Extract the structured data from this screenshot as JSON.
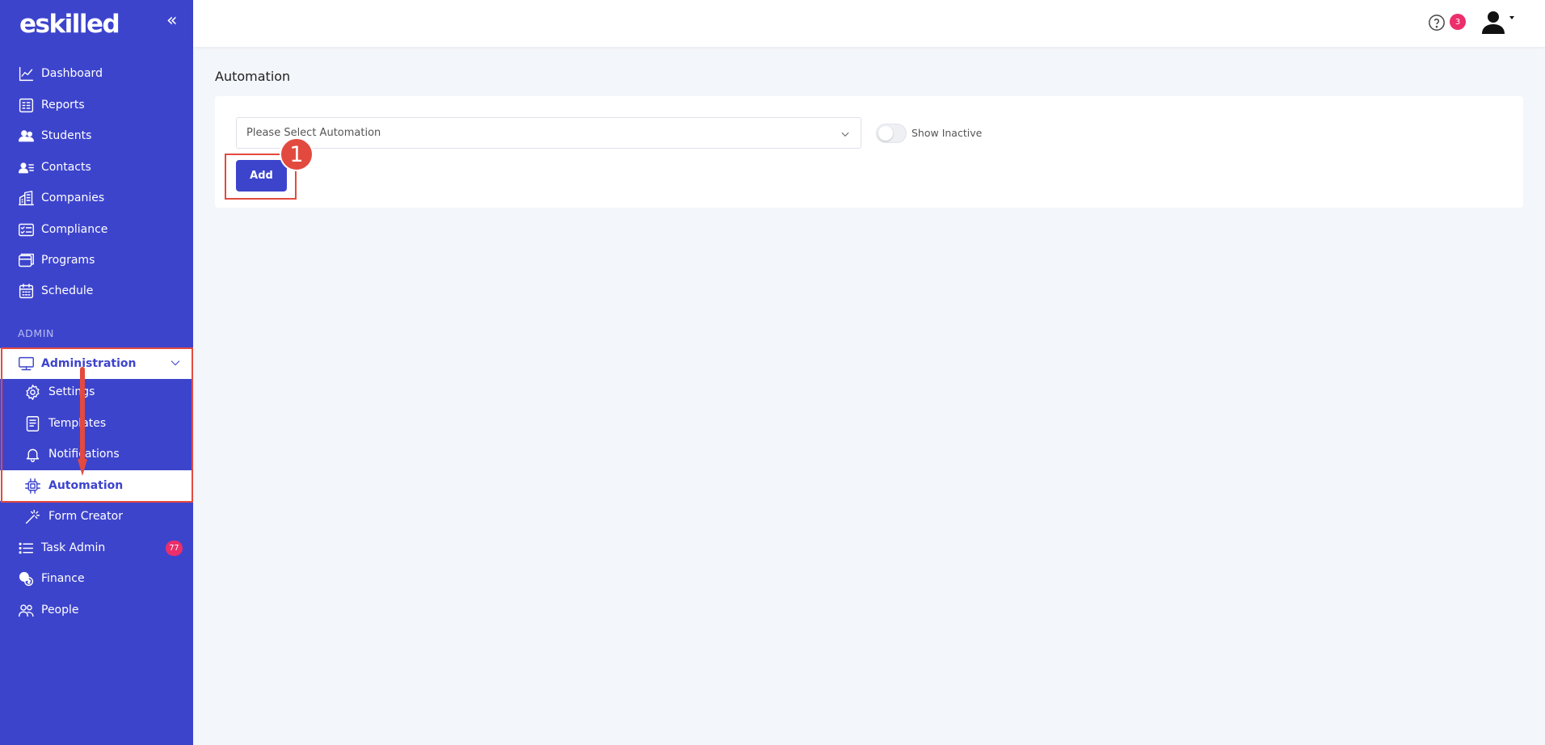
{
  "brand": {
    "logo_text": "eskilled",
    "accent": "#3d44cc",
    "badge_color": "#ec2e6b",
    "annotation_color": "#e34a3f"
  },
  "sidebar": {
    "collapse_icon": "chevrons-left-icon",
    "items": [
      {
        "label": "Dashboard",
        "icon": "chart-line-icon"
      },
      {
        "label": "Reports",
        "icon": "report-icon"
      },
      {
        "label": "Students",
        "icon": "users-icon"
      },
      {
        "label": "Contacts",
        "icon": "contact-card-icon"
      },
      {
        "label": "Companies",
        "icon": "buildings-icon"
      },
      {
        "label": "Compliance",
        "icon": "checklist-icon"
      },
      {
        "label": "Programs",
        "icon": "folders-icon"
      },
      {
        "label": "Schedule",
        "icon": "calendar-icon"
      }
    ],
    "section_header": "ADMIN",
    "admin": {
      "label": "Administration",
      "icon": "monitor-icon",
      "expanded": true,
      "children": [
        {
          "label": "Settings",
          "icon": "gear-icon"
        },
        {
          "label": "Templates",
          "icon": "document-icon"
        },
        {
          "label": "Notifications",
          "icon": "bell-icon"
        },
        {
          "label": "Automation",
          "icon": "chip-icon",
          "active": true
        },
        {
          "label": "Form Creator",
          "icon": "magic-wand-icon"
        }
      ]
    },
    "bottom_items": [
      {
        "label": "Task Admin",
        "icon": "list-icon",
        "badge": "77"
      },
      {
        "label": "Finance",
        "icon": "coins-icon"
      },
      {
        "label": "People",
        "icon": "people-icon"
      }
    ]
  },
  "topbar": {
    "help_icon": "help-circle-icon",
    "notification_count": "3",
    "user_icon": "user-icon"
  },
  "main": {
    "title": "Automation",
    "select": {
      "placeholder": "Please Select Automation"
    },
    "toggle": {
      "label": "Show Inactive",
      "on": false
    },
    "add_label": "Add"
  },
  "annotation": {
    "step": "1"
  }
}
